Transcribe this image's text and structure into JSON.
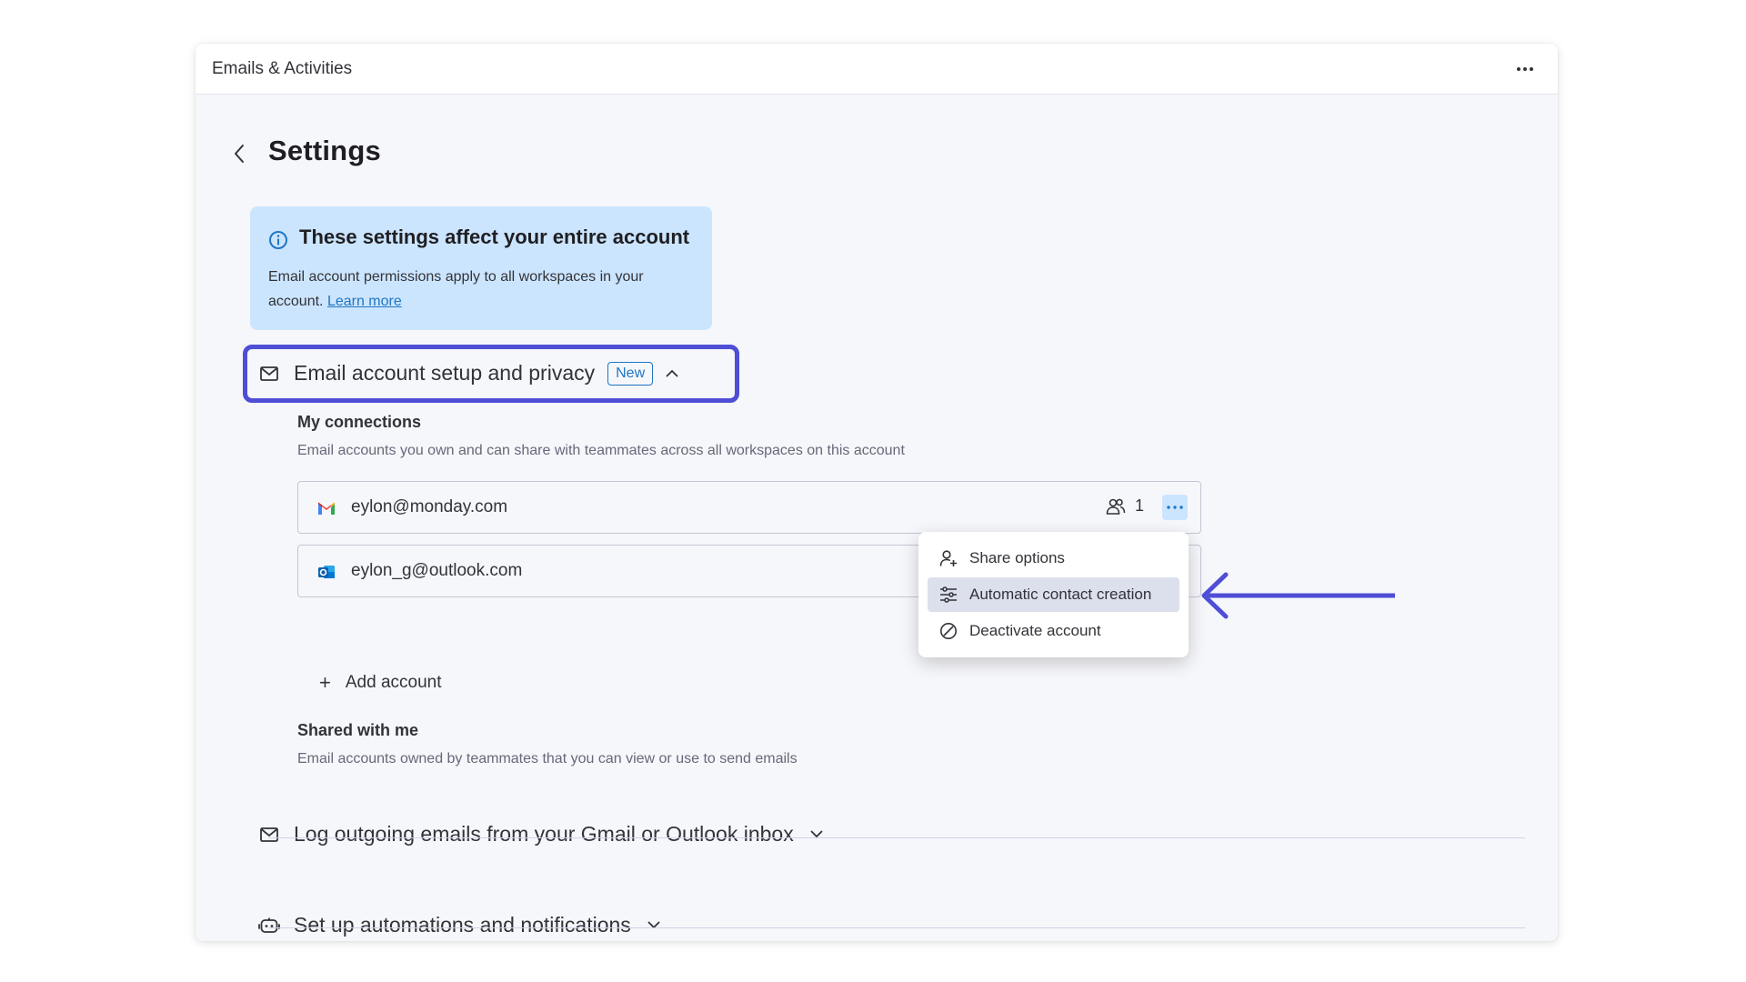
{
  "window": {
    "title": "Emails & Activities"
  },
  "page": {
    "title": "Settings"
  },
  "info": {
    "title": "These settings affect your entire account",
    "text": "Email account permissions apply to all workspaces in your account.",
    "link": "Learn more"
  },
  "sections": {
    "email_setup": {
      "label": "Email account setup and privacy",
      "badge": "New"
    },
    "log_outgoing": {
      "label": "Log outgoing emails from your Gmail or Outlook inbox"
    },
    "automations": {
      "label": "Set up automations and notifications"
    }
  },
  "my_connections": {
    "title": "My connections",
    "description": "Email accounts you own and can share with teammates across all workspaces on this account",
    "accounts": [
      {
        "email": "eylon@monday.com",
        "provider": "gmail",
        "share_count": "1"
      },
      {
        "email": "eylon_g@outlook.com",
        "provider": "outlook"
      }
    ],
    "add_label": "Add account"
  },
  "shared_with_me": {
    "title": "Shared with me",
    "description": "Email accounts owned by teammates that you can view or use to send emails"
  },
  "menu": {
    "items": [
      {
        "label": "Share options",
        "icon": "person-add-icon"
      },
      {
        "label": "Automatic contact creation",
        "icon": "sliders-icon",
        "active": true
      },
      {
        "label": "Deactivate account",
        "icon": "block-icon"
      }
    ]
  },
  "colors": {
    "accent": "#4e4ed6",
    "link": "#1f76c2",
    "info_bg": "#cce5ff"
  }
}
